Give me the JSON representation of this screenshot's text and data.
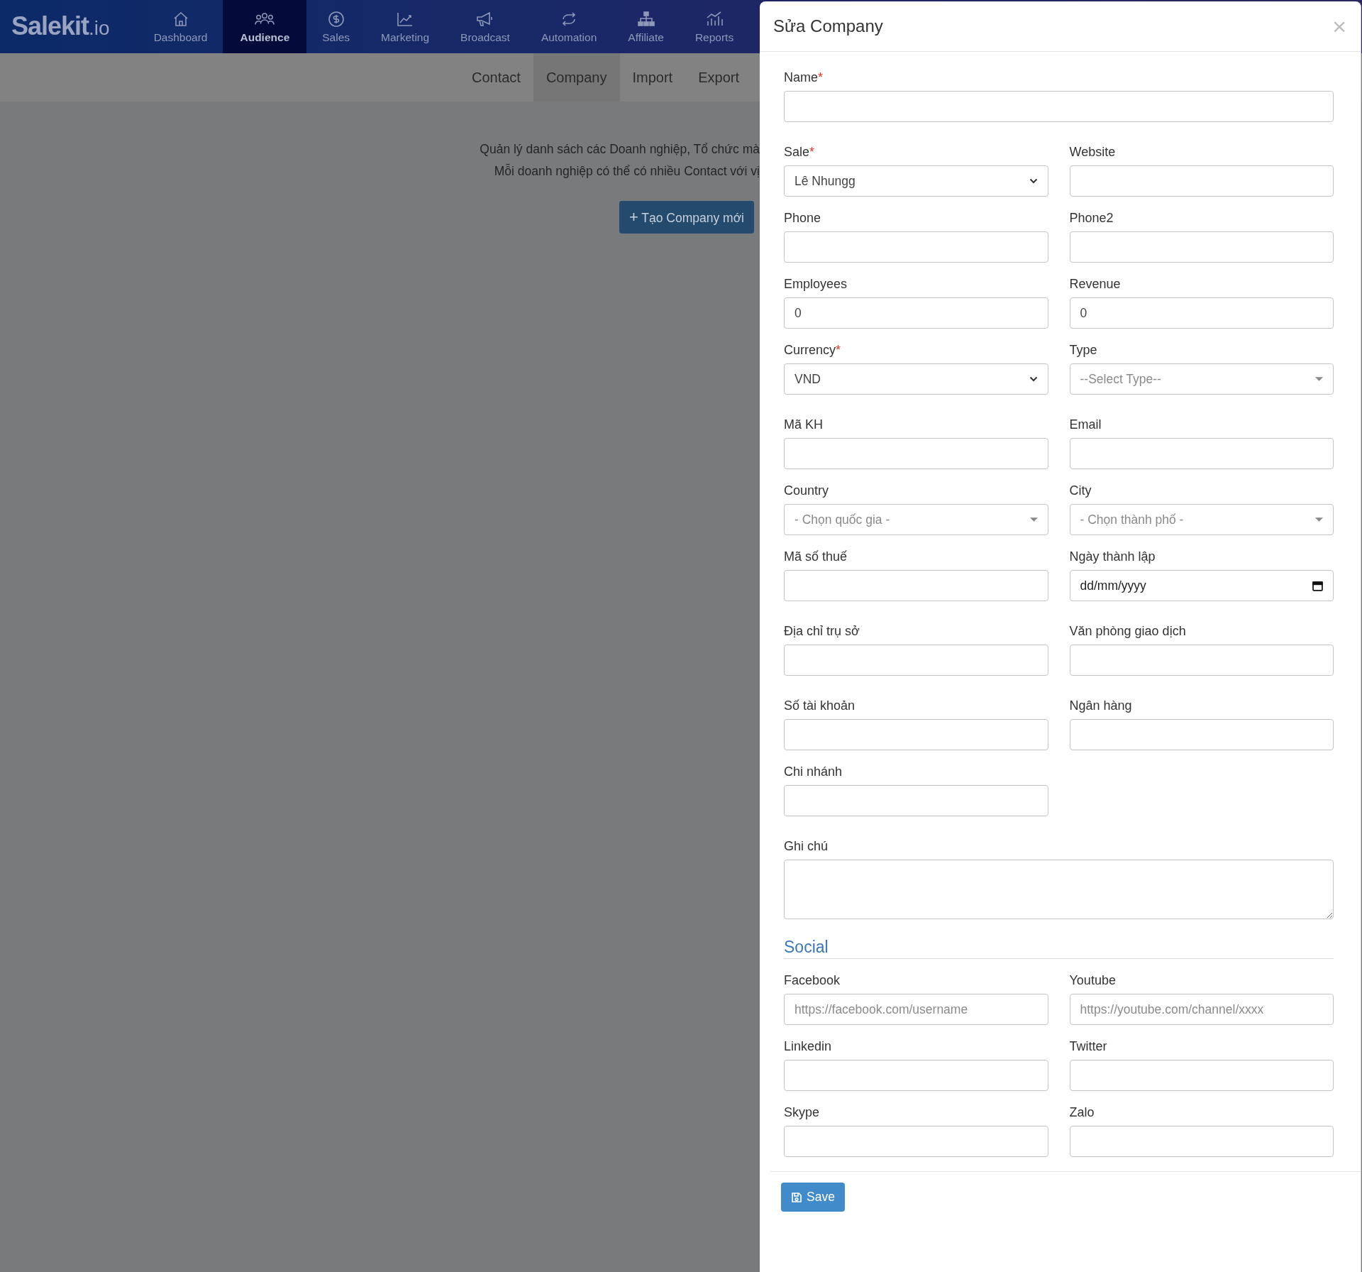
{
  "nav": {
    "logo": {
      "name": "Salekit",
      "suffix": ".io"
    },
    "items": [
      {
        "label": "Dashboard",
        "kind": "home",
        "selected": false
      },
      {
        "label": "Audience",
        "kind": "people",
        "selected": true
      },
      {
        "label": "Sales",
        "kind": "dollar",
        "selected": false
      },
      {
        "label": "Marketing",
        "kind": "chart",
        "selected": false
      },
      {
        "label": "Broadcast",
        "kind": "megaphone",
        "selected": false
      },
      {
        "label": "Automation",
        "kind": "repeat",
        "selected": false
      },
      {
        "label": "Affiliate",
        "kind": "org",
        "selected": false
      },
      {
        "label": "Reports",
        "kind": "bars",
        "selected": false
      }
    ]
  },
  "subtabs": [
    {
      "label": "Contact",
      "selected": false
    },
    {
      "label": "Company",
      "selected": true
    },
    {
      "label": "Import",
      "selected": false
    },
    {
      "label": "Export",
      "selected": false
    }
  ],
  "page": {
    "description": [
      "Quản lý danh sách các Doanh nghiệp, Tổ chức mà",
      "Mỗi doanh nghiệp có thể có nhiều Contact với vị"
    ],
    "create_button": {
      "icon": "+",
      "label": "Tạo Company mới"
    }
  },
  "modal": {
    "title": "Sửa Company",
    "close": "×",
    "groups": [
      {
        "rows": [
          [
            {
              "label": "Name",
              "mark": "*",
              "kind": "text",
              "wide": true
            }
          ]
        ]
      },
      {
        "rows": [
          [
            {
              "label": "Sale",
              "mark": "*",
              "kind": "select",
              "value": "Lê Nhungg"
            },
            {
              "label": "Website",
              "kind": "text"
            }
          ],
          [
            {
              "label": "Phone",
              "kind": "text"
            },
            {
              "label": "Phone2",
              "kind": "text"
            }
          ],
          [
            {
              "label": "Employees",
              "kind": "text",
              "value": "0"
            },
            {
              "label": "Revenue",
              "kind": "text",
              "value": "0"
            }
          ],
          [
            {
              "label": "Currency",
              "mark": "*",
              "kind": "select",
              "value": "VND"
            },
            {
              "label": "Type",
              "kind": "select2",
              "placeholder": "--Select Type--"
            }
          ]
        ]
      },
      {
        "rows": [
          [
            {
              "label": "Mã KH",
              "kind": "text"
            },
            {
              "label": "Email",
              "kind": "text"
            }
          ],
          [
            {
              "label": "Country",
              "kind": "select2",
              "placeholder": "- Chọn quốc gia -"
            },
            {
              "label": "City",
              "kind": "select2",
              "placeholder": "- Chọn thành phố -"
            }
          ],
          [
            {
              "label": "Mã số thuế",
              "kind": "text"
            },
            {
              "label": "Ngày thành lập",
              "kind": "date",
              "value": "dd/mm/yyyy"
            }
          ]
        ]
      },
      {
        "rows": [
          [
            {
              "label": "Địa chỉ trụ sở",
              "kind": "text"
            },
            {
              "label": "Văn phòng giao dịch",
              "kind": "text"
            }
          ]
        ]
      },
      {
        "rows": [
          [
            {
              "label": "Số tài khoản",
              "kind": "text"
            },
            {
              "label": "Ngân hàng",
              "kind": "text"
            }
          ],
          [
            {
              "label": "Chi nhánh",
              "kind": "text"
            }
          ]
        ]
      },
      {
        "rows": [
          [
            {
              "label": "Ghi chú",
              "kind": "textarea",
              "wide": true
            }
          ]
        ]
      }
    ],
    "social": {
      "title": "Social",
      "rows": [
        [
          {
            "label": "Facebook",
            "kind": "text",
            "placeholder": "https://facebook.com/username"
          },
          {
            "label": "Youtube",
            "kind": "text",
            "placeholder": "https://youtube.com/channel/xxxx"
          }
        ],
        [
          {
            "label": "Linkedin",
            "kind": "text"
          },
          {
            "label": "Twitter",
            "kind": "text"
          }
        ],
        [
          {
            "label": "Skype",
            "kind": "text"
          },
          {
            "label": "Zalo",
            "kind": "text"
          }
        ]
      ]
    },
    "save_button": "Save"
  }
}
